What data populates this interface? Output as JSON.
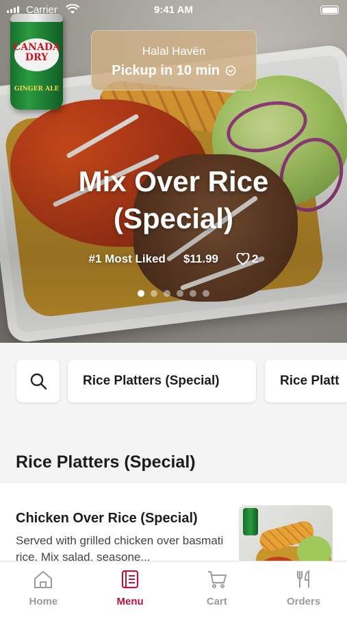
{
  "status_bar": {
    "carrier": "Carrier",
    "time": "9:41 AM"
  },
  "restaurant": {
    "name": "Halal Havën",
    "pickup": "Pickup in 10 min"
  },
  "hero": {
    "title_line1": "Mix Over Rice",
    "title_line2": "(Special)",
    "badge": "#1 Most Liked",
    "price": "$11.99",
    "likes": "2",
    "slides_total": 6,
    "active_slide": 1,
    "can": {
      "brand": "CANADA DRY",
      "sub": "GINGER ALE"
    }
  },
  "categories": {
    "search_icon": "search-icon",
    "chips": [
      "Rice Platters (Special)",
      "Rice Platt"
    ]
  },
  "section": {
    "title": "Rice Platters (Special)"
  },
  "menu_item": {
    "name": "Chicken Over Rice (Special)",
    "description": "Served with grilled chicken over basmati rice. Mix salad, seasone..."
  },
  "tabs": [
    {
      "label": "Home",
      "icon": "home-icon",
      "active": false
    },
    {
      "label": "Menu",
      "icon": "menu-icon",
      "active": true
    },
    {
      "label": "Cart",
      "icon": "cart-icon",
      "active": false
    },
    {
      "label": "Orders",
      "icon": "orders-icon",
      "active": false
    }
  ],
  "colors": {
    "accent": "#b5163c",
    "inactive_tab": "#9b9b9b"
  }
}
